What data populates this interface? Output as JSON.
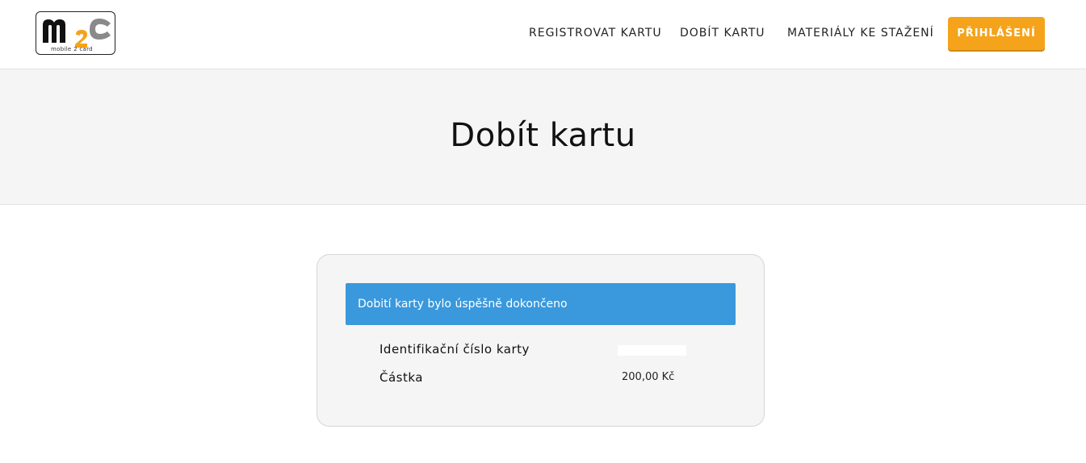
{
  "header": {
    "logo": {
      "alt": "m2c mobile 2 card",
      "tagline": "mobile 2 card",
      "accent_color": "#f5a31a"
    },
    "nav": [
      {
        "label": "REGISTROVAT KARTU"
      },
      {
        "label": "DOBÍT KARTU"
      },
      {
        "label": "MATERIÁLY KE STAŽENÍ"
      }
    ],
    "login_label": "PŘIHLÁŠENÍ"
  },
  "hero": {
    "title": "Dobít kartu"
  },
  "result": {
    "message": "Dobití karty bylo úspěšně dokončeno",
    "message_color": "#3a98dc",
    "rows": [
      {
        "label": "Identifikační číslo karty",
        "value": ""
      },
      {
        "label": "Částka",
        "value": "200,00 Kč"
      }
    ]
  }
}
